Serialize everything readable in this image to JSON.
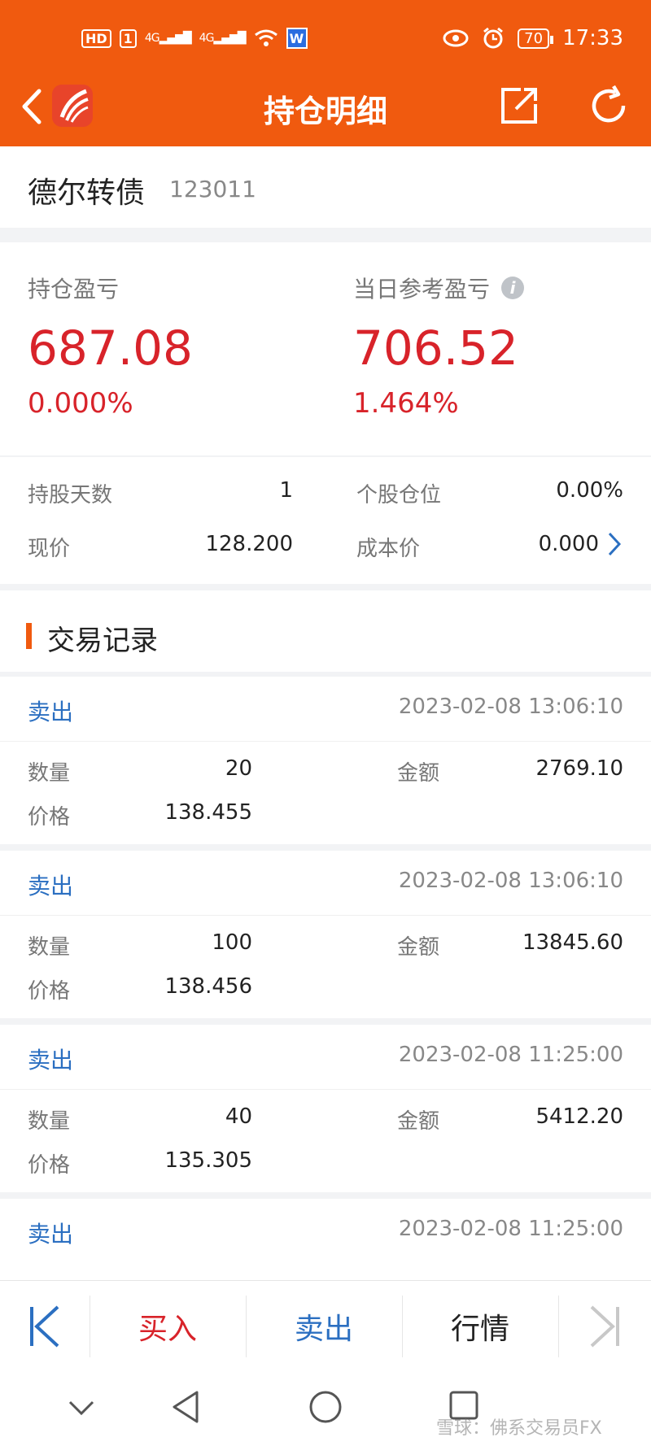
{
  "status_bar": {
    "hd_label": "HD",
    "sim_label": "1",
    "signal_1": "4G",
    "signal_2": "4G",
    "battery": "70",
    "time": "17:33"
  },
  "nav": {
    "title": "持仓明细"
  },
  "stock": {
    "name": "德尔转债",
    "code": "123011"
  },
  "pnl": {
    "position_label": "持仓盈亏",
    "position_value": "687.08",
    "position_pct": "0.000%",
    "daily_label": "当日参考盈亏",
    "daily_value": "706.52",
    "daily_pct": "1.464%"
  },
  "stats": {
    "hold_days_label": "持股天数",
    "hold_days_value": "1",
    "position_ratio_label": "个股仓位",
    "position_ratio_value": "0.00%",
    "price_label": "现价",
    "price_value": "128.200",
    "cost_label": "成本价",
    "cost_value": "0.000"
  },
  "records_title": "交易记录",
  "records": [
    {
      "type": "卖出",
      "time": "2023-02-08 13:06:10",
      "qty_label": "数量",
      "qty": "20",
      "amount_label": "金额",
      "amount": "2769.10",
      "price_label": "价格",
      "price": "138.455"
    },
    {
      "type": "卖出",
      "time": "2023-02-08 13:06:10",
      "qty_label": "数量",
      "qty": "100",
      "amount_label": "金额",
      "amount": "13845.60",
      "price_label": "价格",
      "price": "138.456"
    },
    {
      "type": "卖出",
      "time": "2023-02-08 11:25:00",
      "qty_label": "数量",
      "qty": "40",
      "amount_label": "金额",
      "amount": "5412.20",
      "price_label": "价格",
      "price": "135.305"
    },
    {
      "type": "卖出",
      "time": "2023-02-08 11:25:00"
    }
  ],
  "actions": {
    "buy": "买入",
    "sell": "卖出",
    "quote": "行情"
  },
  "watermark": "雪球：佛系交易员FX",
  "colors": {
    "brand": "#f05a0f",
    "profit_red": "#d8232a",
    "link_blue": "#2b6fc1"
  }
}
